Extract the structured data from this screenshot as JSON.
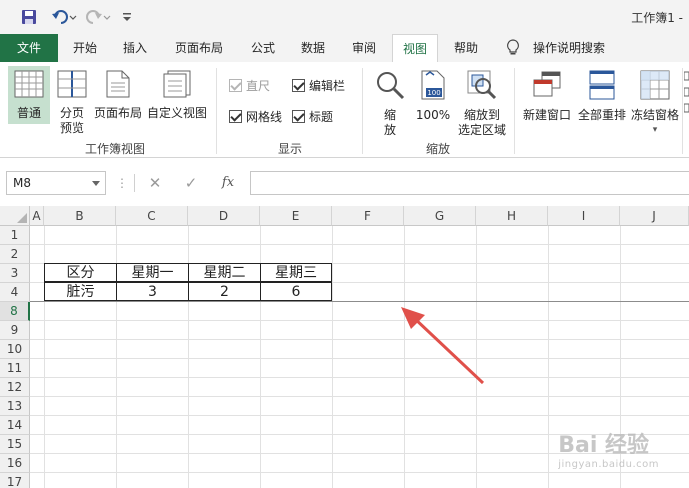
{
  "window": {
    "title": "工作簿1 -"
  },
  "qat": {
    "save_icon": "save-icon",
    "undo_icon": "undo-icon",
    "redo_icon": "redo-icon",
    "customize_icon": "customize-qat-icon"
  },
  "tabs": [
    {
      "label": "文件"
    },
    {
      "label": "开始"
    },
    {
      "label": "插入"
    },
    {
      "label": "页面布局"
    },
    {
      "label": "公式"
    },
    {
      "label": "数据"
    },
    {
      "label": "审阅"
    },
    {
      "label": "视图"
    },
    {
      "label": "帮助"
    },
    {
      "label": "操作说明搜索"
    }
  ],
  "ribbon": {
    "workbook_views": {
      "label": "工作簿视图",
      "normal": "普通",
      "page_break_1": "分页",
      "page_break_2": "预览",
      "page_layout": "页面布局",
      "custom_views": "自定义视图"
    },
    "show": {
      "label": "显示",
      "ruler": "直尺",
      "formula_bar": "编辑栏",
      "gridlines": "网格线",
      "headings": "标题"
    },
    "zoom": {
      "label": "缩放",
      "zoom_1": "缩",
      "zoom_2": "放",
      "zoom_100": "100%",
      "zoom_sel_1": "缩放到",
      "zoom_sel_2": "选定区域"
    },
    "window": {
      "new_window": "新建窗口",
      "arrange_all": "全部重排",
      "freeze_panes": "冻结窗格"
    }
  },
  "formula_bar": {
    "name_box": "M8",
    "cancel": "✕",
    "enter": "✓",
    "fx": "fx",
    "value": ""
  },
  "columns": [
    "A",
    "B",
    "C",
    "D",
    "E",
    "F",
    "G",
    "H",
    "I",
    "J"
  ],
  "rows": [
    "1",
    "2",
    "3",
    "4",
    "8",
    "9",
    "10",
    "11",
    "12",
    "13",
    "14",
    "15",
    "16",
    "17"
  ],
  "table": {
    "header": [
      "区分",
      "星期一",
      "星期二",
      "星期三"
    ],
    "row": [
      "脏污",
      "3",
      "2",
      "6"
    ]
  },
  "watermark": {
    "main": "Bai 经验",
    "sub": "jingyan.baidu.com"
  },
  "colors": {
    "accent": "#217346",
    "arrow": "#e0504a"
  }
}
